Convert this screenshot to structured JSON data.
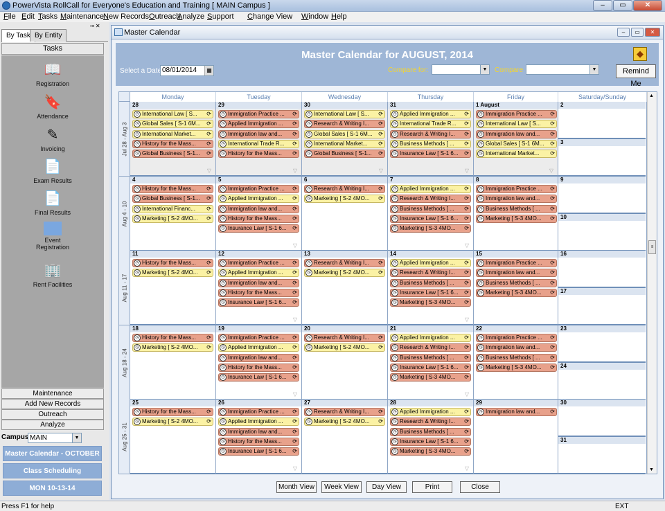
{
  "app": {
    "title": "PowerVista RollCall for Everyone's Education and Training   [ MAIN Campus ]",
    "menus": [
      "File",
      "Edit",
      "Tasks",
      "Maintenance",
      "New Records",
      "Outreach",
      "Analyze",
      "Support",
      "Change View",
      "Window",
      "Help"
    ],
    "window_buttons": {
      "minimize": "‒",
      "maximize": "▭",
      "close": "✕"
    }
  },
  "left": {
    "tab_task": "By Task",
    "tab_entity": "By Entity",
    "tasks_header": "Tasks",
    "tasks": [
      "Registration",
      "Attendance",
      "Invoicing",
      "Exam Results",
      "Final Results",
      "Event Registration",
      "Rent Facilities"
    ],
    "sections": [
      "Maintenance",
      "Add New Records",
      "Outreach",
      "Analyze"
    ],
    "campus_label": "Campus",
    "campus_value": "MAIN",
    "btn1": "Master Calendar - OCTOBER",
    "btn2": "Class Scheduling",
    "btn3": "MON 10-13-14"
  },
  "child": {
    "title": "Master Calendar",
    "heading": "Master Calendar for AUGUST, 2014",
    "select_date_label": "Select a Date",
    "select_date_value": "08/01/2014",
    "compare_for_label": "Compare for:",
    "compare_label": "Compare",
    "remind_label": "Remind Me",
    "days": [
      "Monday",
      "Tuesday",
      "Wednesday",
      "Thursday",
      "Friday",
      "Saturday/Sunday"
    ],
    "weeks": [
      {
        "label": "Jul 28 - Aug 3",
        "sat": "2",
        "sun": "3",
        "days": [
          {
            "n": "28",
            "ev": [
              [
                "International Law [ S...",
                "y"
              ],
              [
                "Global Sales [ S-1 6M...",
                "y"
              ],
              [
                "International Market...",
                "y"
              ],
              [
                "History for the Mass...",
                "o"
              ],
              [
                "Global Business [ S-1...",
                "o"
              ]
            ]
          },
          {
            "n": "29",
            "ev": [
              [
                "Immigration Practice ...",
                "o"
              ],
              [
                "Applied Immigration ...",
                "o"
              ],
              [
                "Immigration law and...",
                "o"
              ],
              [
                "International Trade R...",
                "y"
              ],
              [
                "History for the Mass...",
                "o"
              ]
            ]
          },
          {
            "n": "30",
            "ev": [
              [
                "International Law [ S...",
                "y"
              ],
              [
                "Research & Writing I...",
                "o"
              ],
              [
                "Global Sales [ S-1 6M...",
                "y"
              ],
              [
                "International Market...",
                "y"
              ],
              [
                "Global Business [ S-1...",
                "o"
              ]
            ]
          },
          {
            "n": "31",
            "ev": [
              [
                "Applied Immigration ...",
                "y"
              ],
              [
                "International Trade R...",
                "y"
              ],
              [
                "Research & Writing I...",
                "o"
              ],
              [
                "Business Methods [ ...",
                "y"
              ],
              [
                "Insurance Law [ S-1 6...",
                "o"
              ]
            ]
          },
          {
            "n": "1 August",
            "ev": [
              [
                "Immigration Practice ...",
                "o"
              ],
              [
                "International Law [ S...",
                "y"
              ],
              [
                "Immigration law and...",
                "o"
              ],
              [
                "Global Sales [ S-1 6M...",
                "y"
              ],
              [
                "International Market...",
                "y"
              ]
            ]
          }
        ]
      },
      {
        "label": "Aug 4 - 10",
        "sat": "9",
        "sun": "10",
        "days": [
          {
            "n": "4",
            "ev": [
              [
                "History for the Mass...",
                "o"
              ],
              [
                "Global Business [ S-1...",
                "o"
              ],
              [
                "International Financ...",
                "y"
              ],
              [
                "Marketing [ S-2 4MO...",
                "y"
              ]
            ]
          },
          {
            "n": "5",
            "ev": [
              [
                "Immigration Practice ...",
                "o"
              ],
              [
                "Applied Immigration ...",
                "y"
              ],
              [
                "Immigration law and...",
                "o"
              ],
              [
                "History for the Mass...",
                "o"
              ],
              [
                "Insurance Law [ S-1 6...",
                "o"
              ]
            ]
          },
          {
            "n": "6",
            "ev": [
              [
                "Research & Writing I...",
                "o"
              ],
              [
                "Marketing [ S-2 4MO...",
                "y"
              ]
            ]
          },
          {
            "n": "7",
            "ev": [
              [
                "Applied Immigration ...",
                "y"
              ],
              [
                "Research & Writing I...",
                "o"
              ],
              [
                "Business Methods [ ...",
                "o"
              ],
              [
                "Insurance Law [ S-1 6...",
                "o"
              ],
              [
                "Marketing [ S-3 4MO...",
                "o"
              ]
            ]
          },
          {
            "n": "8",
            "ev": [
              [
                "Immigration Practice ...",
                "o"
              ],
              [
                "Immigration law and...",
                "o"
              ],
              [
                "Business Methods [ ...",
                "o"
              ],
              [
                "Marketing [ S-3 4MO...",
                "o"
              ]
            ]
          }
        ]
      },
      {
        "label": "Aug 11 - 17",
        "sat": "16",
        "sun": "17",
        "days": [
          {
            "n": "11",
            "ev": [
              [
                "History for the Mass...",
                "o"
              ],
              [
                "Marketing [ S-2 4MO...",
                "y"
              ]
            ]
          },
          {
            "n": "12",
            "ev": [
              [
                "Immigration Practice ...",
                "o"
              ],
              [
                "Applied Immigration ...",
                "y"
              ],
              [
                "Immigration law and...",
                "o"
              ],
              [
                "History for the Mass...",
                "o"
              ],
              [
                "Insurance Law [ S-1 6...",
                "o"
              ]
            ]
          },
          {
            "n": "13",
            "ev": [
              [
                "Research & Writing I...",
                "o"
              ],
              [
                "Marketing [ S-2 4MO...",
                "y"
              ]
            ]
          },
          {
            "n": "14",
            "ev": [
              [
                "Applied Immigration ...",
                "y"
              ],
              [
                "Research & Writing I...",
                "o"
              ],
              [
                "Business Methods [ ...",
                "o"
              ],
              [
                "Insurance Law [ S-1 6...",
                "o"
              ],
              [
                "Marketing [ S-3 4MO...",
                "o"
              ]
            ]
          },
          {
            "n": "15",
            "ev": [
              [
                "Immigration Practice ...",
                "o"
              ],
              [
                "Immigration law and...",
                "o"
              ],
              [
                "Business Methods [ ...",
                "o"
              ],
              [
                "Marketing [ S-3 4MO...",
                "o"
              ]
            ]
          }
        ]
      },
      {
        "label": "Aug 18 - 24",
        "sat": "23",
        "sun": "24",
        "days": [
          {
            "n": "18",
            "ev": [
              [
                "History for the Mass...",
                "o"
              ],
              [
                "Marketing [ S-2 4MO...",
                "y"
              ]
            ]
          },
          {
            "n": "19",
            "ev": [
              [
                "Immigration Practice ...",
                "o"
              ],
              [
                "Applied Immigration ...",
                "y"
              ],
              [
                "Immigration law and...",
                "o"
              ],
              [
                "History for the Mass...",
                "o"
              ],
              [
                "Insurance Law [ S-1 6...",
                "o"
              ]
            ]
          },
          {
            "n": "20",
            "ev": [
              [
                "Research & Writing I...",
                "o"
              ],
              [
                "Marketing [ S-2 4MO...",
                "y"
              ]
            ]
          },
          {
            "n": "21",
            "ev": [
              [
                "Applied Immigration ...",
                "y"
              ],
              [
                "Research & Writing I...",
                "o"
              ],
              [
                "Business Methods [ ...",
                "o"
              ],
              [
                "Insurance Law [ S-1 6...",
                "o"
              ],
              [
                "Marketing [ S-3 4MO...",
                "o"
              ]
            ]
          },
          {
            "n": "22",
            "ev": [
              [
                "Immigration Practice ...",
                "o"
              ],
              [
                "Immigration law and...",
                "o"
              ],
              [
                "Business Methods [ ...",
                "o"
              ],
              [
                "Marketing [ S-3 4MO...",
                "o"
              ]
            ]
          }
        ]
      },
      {
        "label": "Aug 25 - 31",
        "sat": "30",
        "sun": "31",
        "days": [
          {
            "n": "25",
            "ev": [
              [
                "History for the Mass...",
                "o"
              ],
              [
                "Marketing [ S-2 4MO...",
                "y"
              ]
            ]
          },
          {
            "n": "26",
            "ev": [
              [
                "Immigration Practice ...",
                "o"
              ],
              [
                "Applied Immigration ...",
                "y"
              ],
              [
                "Immigration law and...",
                "o"
              ],
              [
                "History for the Mass...",
                "o"
              ],
              [
                "Insurance Law [ S-1 6...",
                "o"
              ]
            ]
          },
          {
            "n": "27",
            "ev": [
              [
                "Research & Writing I...",
                "o"
              ],
              [
                "Marketing [ S-2 4MO...",
                "y"
              ]
            ]
          },
          {
            "n": "28",
            "ev": [
              [
                "Applied Immigration ...",
                "y"
              ],
              [
                "Research & Writing I...",
                "o"
              ],
              [
                "Business Methods [ ...",
                "o"
              ],
              [
                "Insurance Law [ S-1 6...",
                "o"
              ],
              [
                "Marketing [ S-3 4MO...",
                "o"
              ]
            ]
          },
          {
            "n": "29",
            "ev": [
              [
                "Immigration law and...",
                "o"
              ]
            ]
          }
        ]
      }
    ],
    "bottom_buttons": [
      "Month View",
      "Week View",
      "Day View",
      "Print",
      "Close"
    ]
  },
  "status": {
    "left": "Press F1 for help",
    "right": "EXT"
  },
  "colors": {
    "event_yellow": "#fbf2a4",
    "event_orange": "#e8a18b",
    "header_blue": "#9eb6d6",
    "nav_blue": "#8eadd6"
  }
}
